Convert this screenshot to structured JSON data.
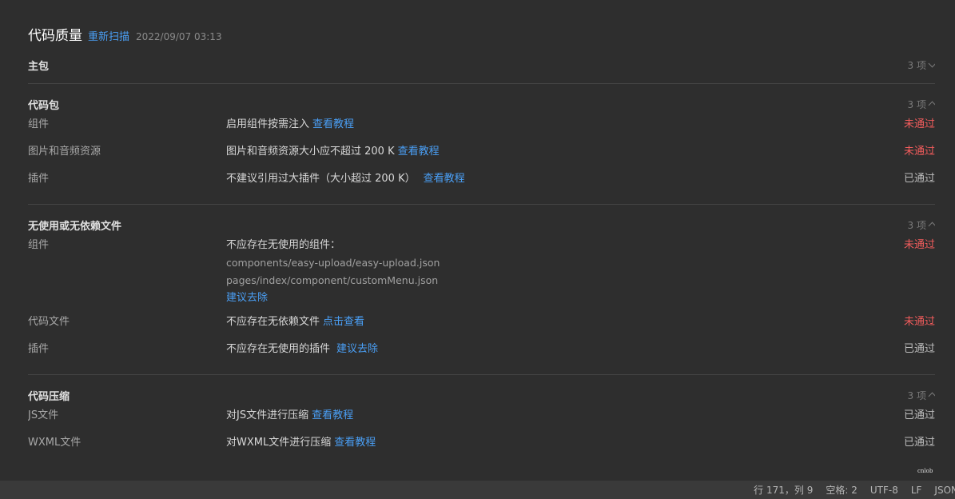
{
  "header": {
    "title": "代码质量",
    "rescan_label": "重新扫描",
    "timestamp": "2022/09/07 03:13"
  },
  "sections": [
    {
      "title": "主包",
      "count": "3 项",
      "expanded": false,
      "rows": []
    },
    {
      "title": "代码包",
      "count": "3 项",
      "expanded": true,
      "rows": [
        {
          "name": "组件",
          "desc": "启用组件按需注入",
          "link": "查看教程",
          "status": "未通过"
        },
        {
          "name": "图片和音频资源",
          "desc": "图片和音频资源大小应不超过 200 K",
          "link": "查看教程",
          "status": "未通过"
        },
        {
          "name": "插件",
          "desc": "不建议引用过大插件（大小超过 200 K）",
          "link": "查看教程",
          "status": "已通过"
        }
      ]
    },
    {
      "title": "无使用或无依赖文件",
      "count": "3 项",
      "expanded": true,
      "rows": [
        {
          "name": "组件",
          "desc": "不应存在无使用的组件：",
          "paths": [
            "components/easy-upload/easy-upload.json",
            "pages/index/component/customMenu.json"
          ],
          "link": "建议去除",
          "status": "未通过"
        },
        {
          "name": "代码文件",
          "desc": "不应存在无依赖文件",
          "link": "点击查看",
          "status": "未通过"
        },
        {
          "name": "插件",
          "desc": "不应存在无使用的插件",
          "link": "建议去除",
          "status": "已通过"
        }
      ]
    },
    {
      "title": "代码压缩",
      "count": "3 项",
      "expanded": true,
      "rows": [
        {
          "name": "JS文件",
          "desc": "对JS文件进行压缩",
          "link": "查看教程",
          "status": "已通过"
        },
        {
          "name": "WXML文件",
          "desc": "对WXML文件进行压缩",
          "link": "查看教程",
          "status": "已通过"
        }
      ]
    }
  ],
  "statusbar": {
    "position": "行 171，列 9",
    "indent": "空格: 2",
    "encoding": "UTF-8",
    "eol": "LF",
    "language": "JSON"
  },
  "colors": {
    "link": "#4a9ff5",
    "fail": "#f25c5c",
    "pass": "#bcbcbc",
    "background": "#2e2e2e"
  }
}
